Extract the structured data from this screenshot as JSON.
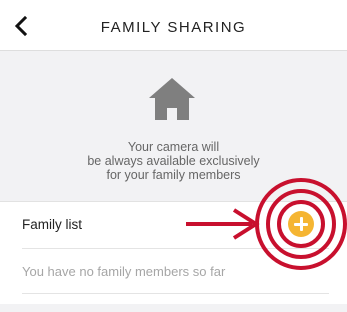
{
  "navbar": {
    "title": "FAMILY SHARING",
    "back_icon": "chevron-left-icon"
  },
  "hero": {
    "icon": "house-icon",
    "lines": [
      "Your camera will",
      "be always available exclusively",
      "for your family members"
    ]
  },
  "list": {
    "family_label": "Family list",
    "empty_text": "You have no family members so far",
    "add_icon": "plus-circle-icon"
  },
  "colors": {
    "accent": "#f5b532",
    "annotation": "#c8102e",
    "background": "#f2f2f4"
  }
}
